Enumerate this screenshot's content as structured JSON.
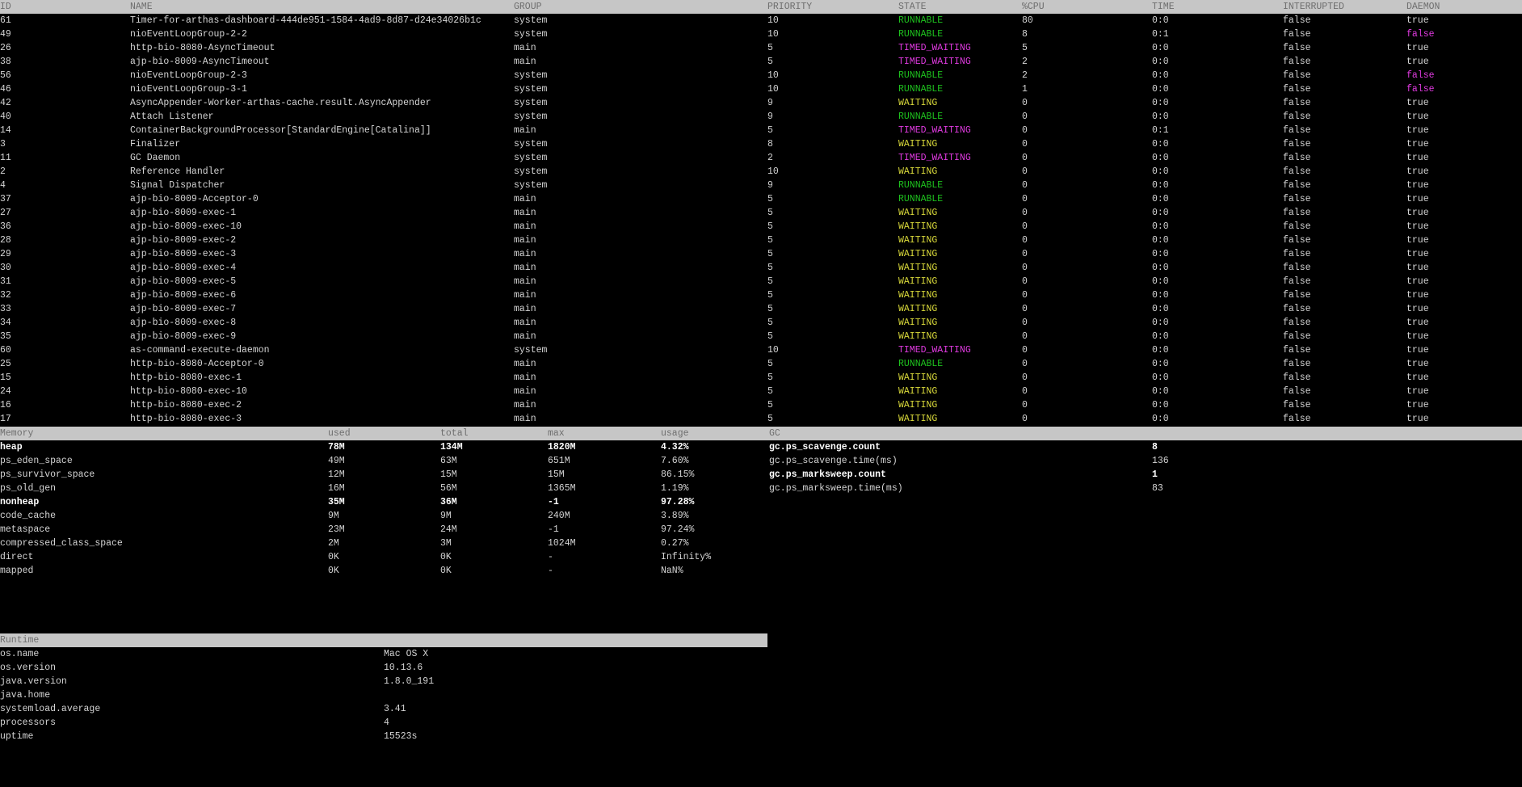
{
  "threads": {
    "headers": [
      "ID",
      "NAME",
      "GROUP",
      "PRIORITY",
      "STATE",
      "%CPU",
      "TIME",
      "INTERRUPTED",
      "DAEMON"
    ],
    "rows": [
      [
        "61",
        "Timer-for-arthas-dashboard-444de951-1584-4ad9-8d87-d24e34026b1c",
        "system",
        "10",
        "RUNNABLE",
        "80",
        "0:0",
        "false",
        "true"
      ],
      [
        "49",
        "nioEventLoopGroup-2-2",
        "system",
        "10",
        "RUNNABLE",
        "8",
        "0:1",
        "false",
        "false"
      ],
      [
        "26",
        "http-bio-8080-AsyncTimeout",
        "main",
        "5",
        "TIMED_WAITING",
        "5",
        "0:0",
        "false",
        "true"
      ],
      [
        "38",
        "ajp-bio-8009-AsyncTimeout",
        "main",
        "5",
        "TIMED_WAITING",
        "2",
        "0:0",
        "false",
        "true"
      ],
      [
        "56",
        "nioEventLoopGroup-2-3",
        "system",
        "10",
        "RUNNABLE",
        "2",
        "0:0",
        "false",
        "false"
      ],
      [
        "46",
        "nioEventLoopGroup-3-1",
        "system",
        "10",
        "RUNNABLE",
        "1",
        "0:0",
        "false",
        "false"
      ],
      [
        "42",
        "AsyncAppender-Worker-arthas-cache.result.AsyncAppender",
        "system",
        "9",
        "WAITING",
        "0",
        "0:0",
        "false",
        "true"
      ],
      [
        "40",
        "Attach Listener",
        "system",
        "9",
        "RUNNABLE",
        "0",
        "0:0",
        "false",
        "true"
      ],
      [
        "14",
        "ContainerBackgroundProcessor[StandardEngine[Catalina]]",
        "main",
        "5",
        "TIMED_WAITING",
        "0",
        "0:1",
        "false",
        "true"
      ],
      [
        "3",
        "Finalizer",
        "system",
        "8",
        "WAITING",
        "0",
        "0:0",
        "false",
        "true"
      ],
      [
        "11",
        "GC Daemon",
        "system",
        "2",
        "TIMED_WAITING",
        "0",
        "0:0",
        "false",
        "true"
      ],
      [
        "2",
        "Reference Handler",
        "system",
        "10",
        "WAITING",
        "0",
        "0:0",
        "false",
        "true"
      ],
      [
        "4",
        "Signal Dispatcher",
        "system",
        "9",
        "RUNNABLE",
        "0",
        "0:0",
        "false",
        "true"
      ],
      [
        "37",
        "ajp-bio-8009-Acceptor-0",
        "main",
        "5",
        "RUNNABLE",
        "0",
        "0:0",
        "false",
        "true"
      ],
      [
        "27",
        "ajp-bio-8009-exec-1",
        "main",
        "5",
        "WAITING",
        "0",
        "0:0",
        "false",
        "true"
      ],
      [
        "36",
        "ajp-bio-8009-exec-10",
        "main",
        "5",
        "WAITING",
        "0",
        "0:0",
        "false",
        "true"
      ],
      [
        "28",
        "ajp-bio-8009-exec-2",
        "main",
        "5",
        "WAITING",
        "0",
        "0:0",
        "false",
        "true"
      ],
      [
        "29",
        "ajp-bio-8009-exec-3",
        "main",
        "5",
        "WAITING",
        "0",
        "0:0",
        "false",
        "true"
      ],
      [
        "30",
        "ajp-bio-8009-exec-4",
        "main",
        "5",
        "WAITING",
        "0",
        "0:0",
        "false",
        "true"
      ],
      [
        "31",
        "ajp-bio-8009-exec-5",
        "main",
        "5",
        "WAITING",
        "0",
        "0:0",
        "false",
        "true"
      ],
      [
        "32",
        "ajp-bio-8009-exec-6",
        "main",
        "5",
        "WAITING",
        "0",
        "0:0",
        "false",
        "true"
      ],
      [
        "33",
        "ajp-bio-8009-exec-7",
        "main",
        "5",
        "WAITING",
        "0",
        "0:0",
        "false",
        "true"
      ],
      [
        "34",
        "ajp-bio-8009-exec-8",
        "main",
        "5",
        "WAITING",
        "0",
        "0:0",
        "false",
        "true"
      ],
      [
        "35",
        "ajp-bio-8009-exec-9",
        "main",
        "5",
        "WAITING",
        "0",
        "0:0",
        "false",
        "true"
      ],
      [
        "60",
        "as-command-execute-daemon",
        "system",
        "10",
        "TIMED_WAITING",
        "0",
        "0:0",
        "false",
        "true"
      ],
      [
        "25",
        "http-bio-8080-Acceptor-0",
        "main",
        "5",
        "RUNNABLE",
        "0",
        "0:0",
        "false",
        "true"
      ],
      [
        "15",
        "http-bio-8080-exec-1",
        "main",
        "5",
        "WAITING",
        "0",
        "0:0",
        "false",
        "true"
      ],
      [
        "24",
        "http-bio-8080-exec-10",
        "main",
        "5",
        "WAITING",
        "0",
        "0:0",
        "false",
        "true"
      ],
      [
        "16",
        "http-bio-8080-exec-2",
        "main",
        "5",
        "WAITING",
        "0",
        "0:0",
        "false",
        "true"
      ],
      [
        "17",
        "http-bio-8080-exec-3",
        "main",
        "5",
        "WAITING",
        "0",
        "0:0",
        "false",
        "true"
      ]
    ]
  },
  "memory": {
    "headers": [
      "Memory",
      "used",
      "total",
      "max",
      "usage"
    ],
    "rows": [
      {
        "cells": [
          "heap",
          "78M",
          "134M",
          "1820M",
          "4.32%"
        ],
        "bold": true
      },
      {
        "cells": [
          "ps_eden_space",
          "49M",
          "63M",
          "651M",
          "7.60%"
        ],
        "bold": false
      },
      {
        "cells": [
          "ps_survivor_space",
          "12M",
          "15M",
          "15M",
          "86.15%"
        ],
        "bold": false
      },
      {
        "cells": [
          "ps_old_gen",
          "16M",
          "56M",
          "1365M",
          "1.19%"
        ],
        "bold": false
      },
      {
        "cells": [
          "nonheap",
          "35M",
          "36M",
          "-1",
          "97.28%"
        ],
        "bold": true
      },
      {
        "cells": [
          "code_cache",
          "9M",
          "9M",
          "240M",
          "3.89%"
        ],
        "bold": false
      },
      {
        "cells": [
          "metaspace",
          "23M",
          "24M",
          "-1",
          "97.24%"
        ],
        "bold": false
      },
      {
        "cells": [
          "compressed_class_space",
          "2M",
          "3M",
          "1024M",
          "0.27%"
        ],
        "bold": false
      },
      {
        "cells": [
          "direct",
          "0K",
          "0K",
          "-",
          "Infinity%"
        ],
        "bold": false
      },
      {
        "cells": [
          "mapped",
          "0K",
          "0K",
          "-",
          "NaN%"
        ],
        "bold": false
      }
    ]
  },
  "gc": {
    "header": "GC",
    "rows": [
      {
        "cells": [
          "gc.ps_scavenge.count",
          "8"
        ],
        "bold": true
      },
      {
        "cells": [
          "gc.ps_scavenge.time(ms)",
          "136"
        ],
        "bold": false
      },
      {
        "cells": [
          "gc.ps_marksweep.count",
          "1"
        ],
        "bold": true
      },
      {
        "cells": [
          "gc.ps_marksweep.time(ms)",
          "83"
        ],
        "bold": false
      }
    ]
  },
  "runtime": {
    "header": "Runtime",
    "rows": [
      [
        "os.name",
        "Mac OS X"
      ],
      [
        "os.version",
        "10.13.6"
      ],
      [
        "java.version",
        "1.8.0_191"
      ],
      [
        "java.home",
        ""
      ],
      [
        "systemload.average",
        "3.41"
      ],
      [
        "processors",
        "4"
      ],
      [
        "uptime",
        "15523s"
      ]
    ]
  }
}
